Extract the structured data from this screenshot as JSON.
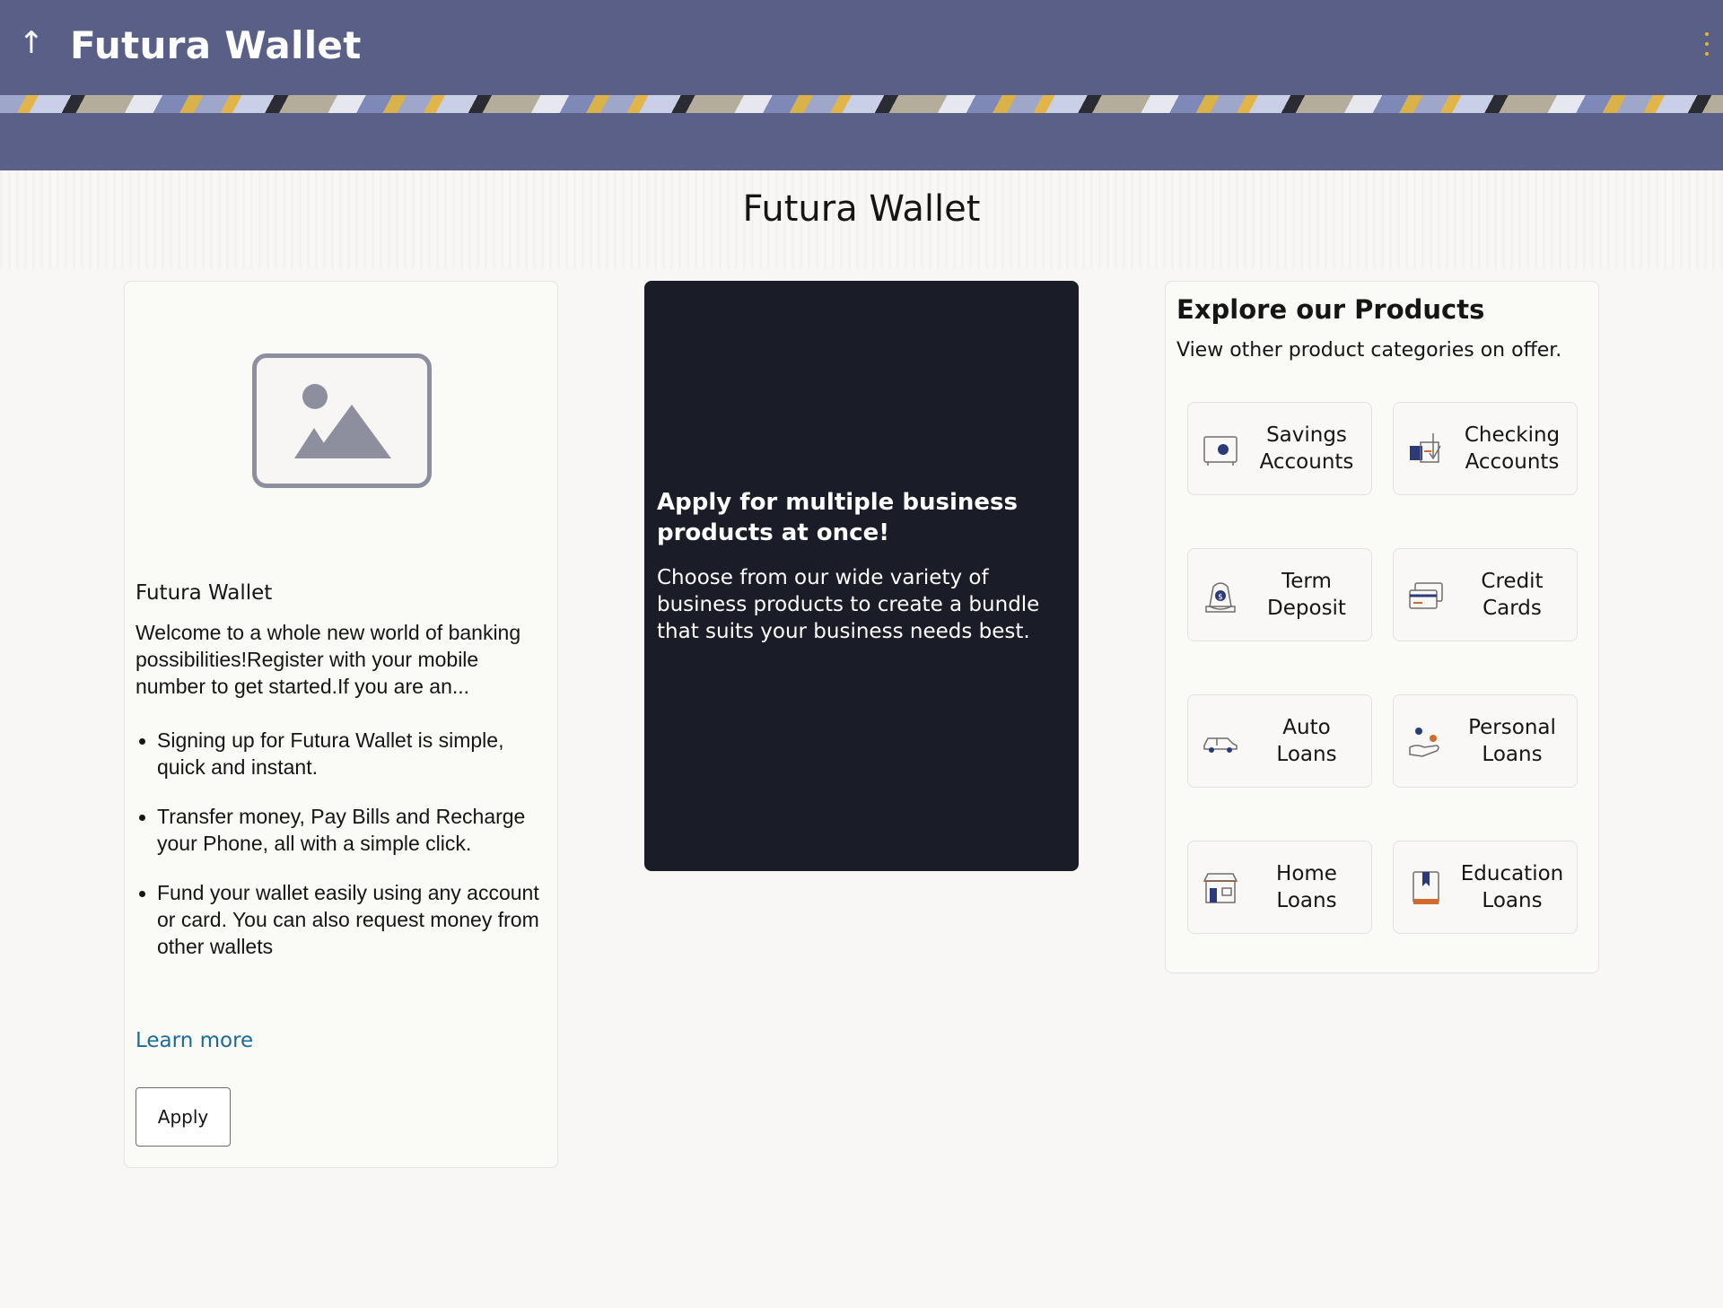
{
  "header": {
    "back_glyph": "↑",
    "app_title": "Futura Wallet",
    "menu_icon": "kebab-menu-icon"
  },
  "page": {
    "title": "Futura Wallet"
  },
  "left_card": {
    "image_icon": "image-placeholder-icon",
    "heading": "Futura Wallet",
    "description": "Welcome to a whole new world of banking possibilities!Register with your mobile number to get started.If you are an...",
    "bullets": [
      "Signing up for Futura Wallet is simple, quick and instant.",
      "Transfer money, Pay Bills and Recharge your Phone, all with a simple click.",
      "Fund your wallet easily using any account or card. You can also request money from other wallets"
    ],
    "learn_more": "Learn more",
    "apply": "Apply"
  },
  "promo_card": {
    "title": "Apply for multiple business products at once!",
    "description": "Choose from our wide variety of business products to create a bundle that suits your business needs best."
  },
  "products": {
    "title": "Explore our Products",
    "subtitle": "View other product categories on offer.",
    "items": [
      {
        "line1": "Savings",
        "line2": "Accounts",
        "icon": "savings-icon"
      },
      {
        "line1": "Checking",
        "line2": "Accounts",
        "icon": "checking-icon"
      },
      {
        "line1": "Term",
        "line2": "Deposit",
        "icon": "term-deposit-icon"
      },
      {
        "line1": "Credit",
        "line2": "Cards",
        "icon": "credit-card-icon"
      },
      {
        "line1": "Auto",
        "line2": "Loans",
        "icon": "car-icon"
      },
      {
        "line1": "Personal",
        "line2": "Loans",
        "icon": "personal-loan-icon"
      },
      {
        "line1": "Home",
        "line2": "Loans",
        "icon": "home-icon"
      },
      {
        "line1": "Education",
        "line2": "Loans",
        "icon": "book-icon"
      }
    ]
  },
  "colors": {
    "header_bg": "#5a5f87",
    "promo_bg": "#1a1d27",
    "link": "#1a6b9a",
    "accent_navy": "#2c3a7a",
    "accent_orange": "#d36b2e"
  }
}
